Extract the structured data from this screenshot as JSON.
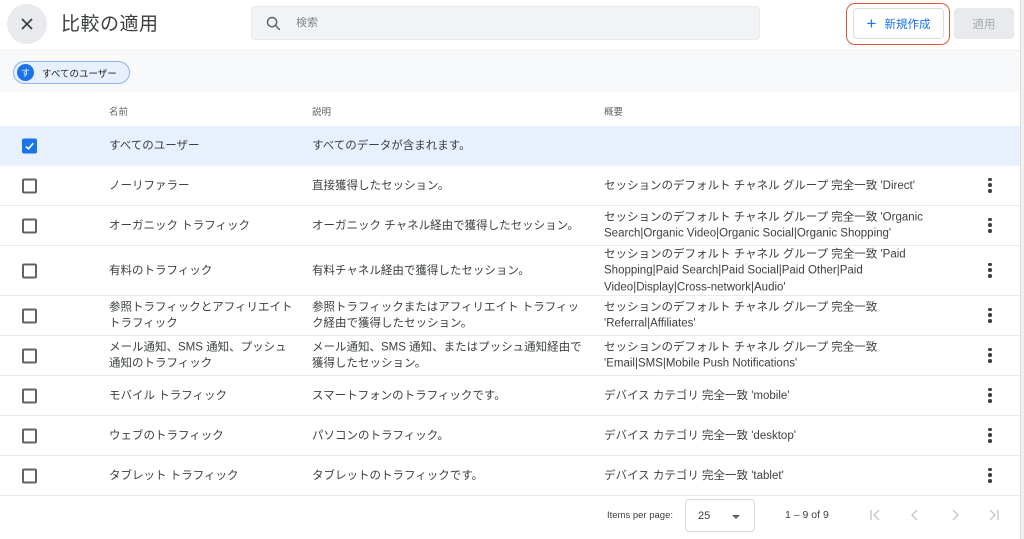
{
  "header": {
    "title": "比較の適用",
    "search_placeholder": "検索",
    "new_button_label": "新規作成",
    "apply_button_label": "適用"
  },
  "chips": [
    {
      "avatar_letter": "す",
      "label": "すべてのユーザー"
    }
  ],
  "table": {
    "columns": {
      "name": "名前",
      "description": "説明",
      "summary": "概要"
    },
    "rows": [
      {
        "checked": true,
        "name": "すべてのユーザー",
        "description": "すべてのデータが含まれます。",
        "summary": "",
        "has_menu": false
      },
      {
        "checked": false,
        "name": "ノーリファラー",
        "description": "直接獲得したセッション。",
        "summary": "セッションのデフォルト チャネル グループ 完全一致 'Direct'",
        "has_menu": true
      },
      {
        "checked": false,
        "name": "オーガニック トラフィック",
        "description": "オーガニック チャネル経由で獲得したセッション。",
        "summary": "セッションのデフォルト チャネル グループ 完全一致 'Organic Search|Organic Video|Organic Social|Organic Shopping'",
        "has_menu": true
      },
      {
        "checked": false,
        "name": "有料のトラフィック",
        "description": "有料チャネル経由で獲得したセッション。",
        "summary": "セッションのデフォルト チャネル グループ 完全一致 'Paid Shopping|Paid Search|Paid Social|Paid Other|Paid Video|Display|Cross-network|Audio'",
        "has_menu": true
      },
      {
        "checked": false,
        "name": "参照トラフィックとアフィリエイト トラフィック",
        "description": "参照トラフィックまたはアフィリエイト トラフィック経由で獲得したセッション。",
        "summary": "セッションのデフォルト チャネル グループ 完全一致 'Referral|Affiliates'",
        "has_menu": true
      },
      {
        "checked": false,
        "name": "メール通知、SMS 通知、プッシュ通知のトラフィック",
        "description": "メール通知、SMS 通知、またはプッシュ通知経由で獲得したセッション。",
        "summary": "セッションのデフォルト チャネル グループ 完全一致 'Email|SMS|Mobile Push Notifications'",
        "has_menu": true
      },
      {
        "checked": false,
        "name": "モバイル トラフィック",
        "description": "スマートフォンのトラフィックです。",
        "summary": "デバイス カテゴリ 完全一致 'mobile'",
        "has_menu": true
      },
      {
        "checked": false,
        "name": "ウェブのトラフィック",
        "description": "パソコンのトラフィック。",
        "summary": "デバイス カテゴリ 完全一致 'desktop'",
        "has_menu": true
      },
      {
        "checked": false,
        "name": "タブレット トラフィック",
        "description": "タブレットのトラフィックです。",
        "summary": "デバイス カテゴリ 完全一致 'tablet'",
        "has_menu": true
      }
    ]
  },
  "paginator": {
    "items_per_page_label": "Items per page:",
    "items_per_page_value": "25",
    "range_label": "1 – 9 of 9"
  },
  "colors": {
    "accent": "#1a73e8",
    "selected_row": "#e8f0fe",
    "highlight_outline": "#e0553c"
  }
}
